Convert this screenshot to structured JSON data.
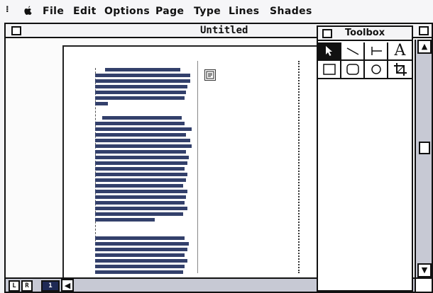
{
  "menubar": {
    "items": [
      "File",
      "Edit",
      "Options",
      "Page",
      "Type",
      "Lines",
      "Shades"
    ]
  },
  "window": {
    "title": "Untitled"
  },
  "toolbox": {
    "title": "Toolbox",
    "tools": [
      {
        "name": "pointer-tool",
        "icon": "arrow-pointer-icon",
        "selected": true
      },
      {
        "name": "diagonal-line-tool",
        "icon": "diagonal-line-icon"
      },
      {
        "name": "perpendicular-line-tool",
        "icon": "perpendicular-line-icon"
      },
      {
        "name": "text-tool",
        "icon": "text-a-icon",
        "glyph": "A"
      },
      {
        "name": "square-corner-box-tool",
        "icon": "rectangle-icon"
      },
      {
        "name": "rounded-box-tool",
        "icon": "rounded-rectangle-icon"
      },
      {
        "name": "oval-tool",
        "icon": "oval-icon"
      },
      {
        "name": "cropping-tool",
        "icon": "crop-icon"
      }
    ]
  },
  "page_tabs": [
    "L",
    "R",
    "1"
  ],
  "colors": {
    "text_bars": "#33406b",
    "selected_tab": "#1f2a55",
    "scroll_track": "#c7c9d4"
  }
}
